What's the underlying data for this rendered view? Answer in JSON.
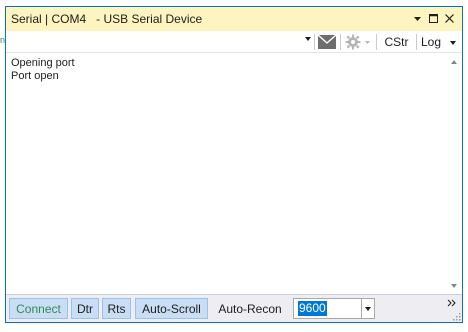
{
  "window": {
    "title": "Serial | COM4   - USB Serial Device",
    "controls": {
      "dropdown_icon": "chevron-down-small",
      "restore_icon": "restore-square",
      "close_icon": "close-x"
    }
  },
  "toolbar": {
    "port_value": "",
    "send_icon": "envelope",
    "settings_icon": "gear",
    "cstr_label": "CStr",
    "log_label": "Log"
  },
  "log": {
    "lines": [
      "Opening port",
      "Port open"
    ]
  },
  "statusbar": {
    "connect_label": "Connect",
    "dtr_label": "Dtr",
    "rts_label": "Rts",
    "autoscroll_label": "Auto-Scroll",
    "autorecon_label": "Auto-Recon",
    "baud_value": "9600",
    "overflow_icon": "double-chevron"
  },
  "colors": {
    "title_bar": "#fdf4bf",
    "window_border": "#0e70c0",
    "toggle_on_bg": "#c9def5",
    "connect_text": "#2e8b57",
    "status_bg": "#eeeef2",
    "selection": "#0078d7"
  }
}
